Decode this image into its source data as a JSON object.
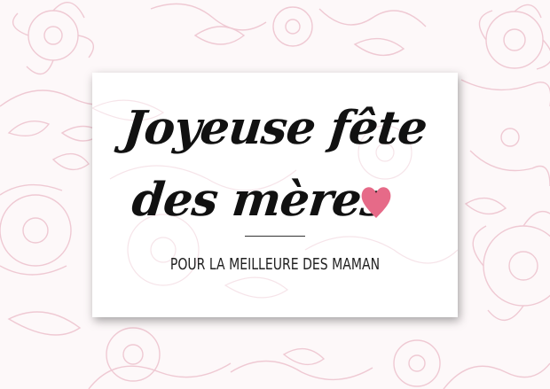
{
  "card": {
    "title_line1": "Joyeuse fête",
    "title_line2": "des mères",
    "subtitle": "POUR LA MEILLEURE DES MAMAN"
  },
  "icons": {
    "heart": "heart-icon"
  },
  "colors": {
    "background": "#fdf8f9",
    "floral_line": "#efc9d3",
    "card": "#ffffff",
    "heart": "#e66a88",
    "text": "#111111"
  }
}
